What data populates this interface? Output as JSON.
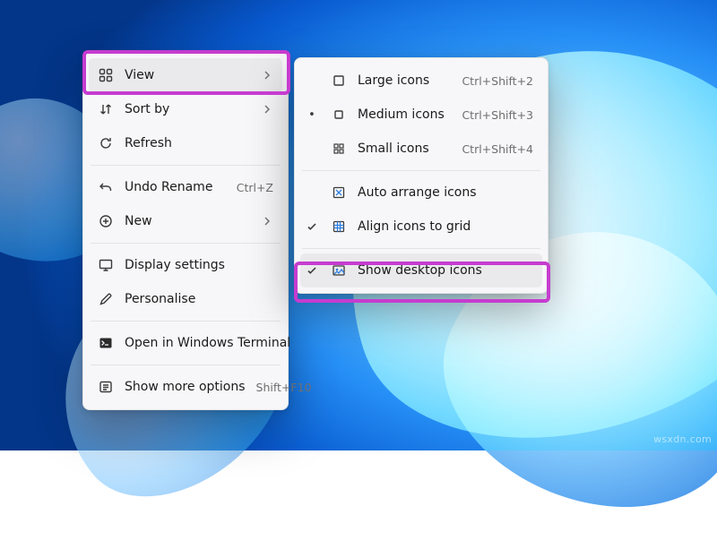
{
  "wallpaper": {
    "name": "windows-11-bloom"
  },
  "watermark": "wsxdn.com",
  "main_menu": {
    "view": {
      "label": "View"
    },
    "sort_by": {
      "label": "Sort by"
    },
    "refresh": {
      "label": "Refresh"
    },
    "undo_rename": {
      "label": "Undo Rename",
      "accel": "Ctrl+Z"
    },
    "new": {
      "label": "New"
    },
    "display_settings": {
      "label": "Display settings"
    },
    "personalise": {
      "label": "Personalise"
    },
    "terminal": {
      "label": "Open in Windows Terminal"
    },
    "more_options": {
      "label": "Show more options",
      "accel": "Shift+F10"
    }
  },
  "view_submenu": {
    "large_icons": {
      "label": "Large icons",
      "accel": "Ctrl+Shift+2"
    },
    "medium_icons": {
      "label": "Medium icons",
      "accel": "Ctrl+Shift+3",
      "selected": true
    },
    "small_icons": {
      "label": "Small icons",
      "accel": "Ctrl+Shift+4"
    },
    "auto_arrange": {
      "label": "Auto arrange icons"
    },
    "align_grid": {
      "label": "Align icons to grid",
      "checked": true
    },
    "show_desktop": {
      "label": "Show desktop icons",
      "checked": true
    }
  },
  "highlight_color": "#c63ccf"
}
